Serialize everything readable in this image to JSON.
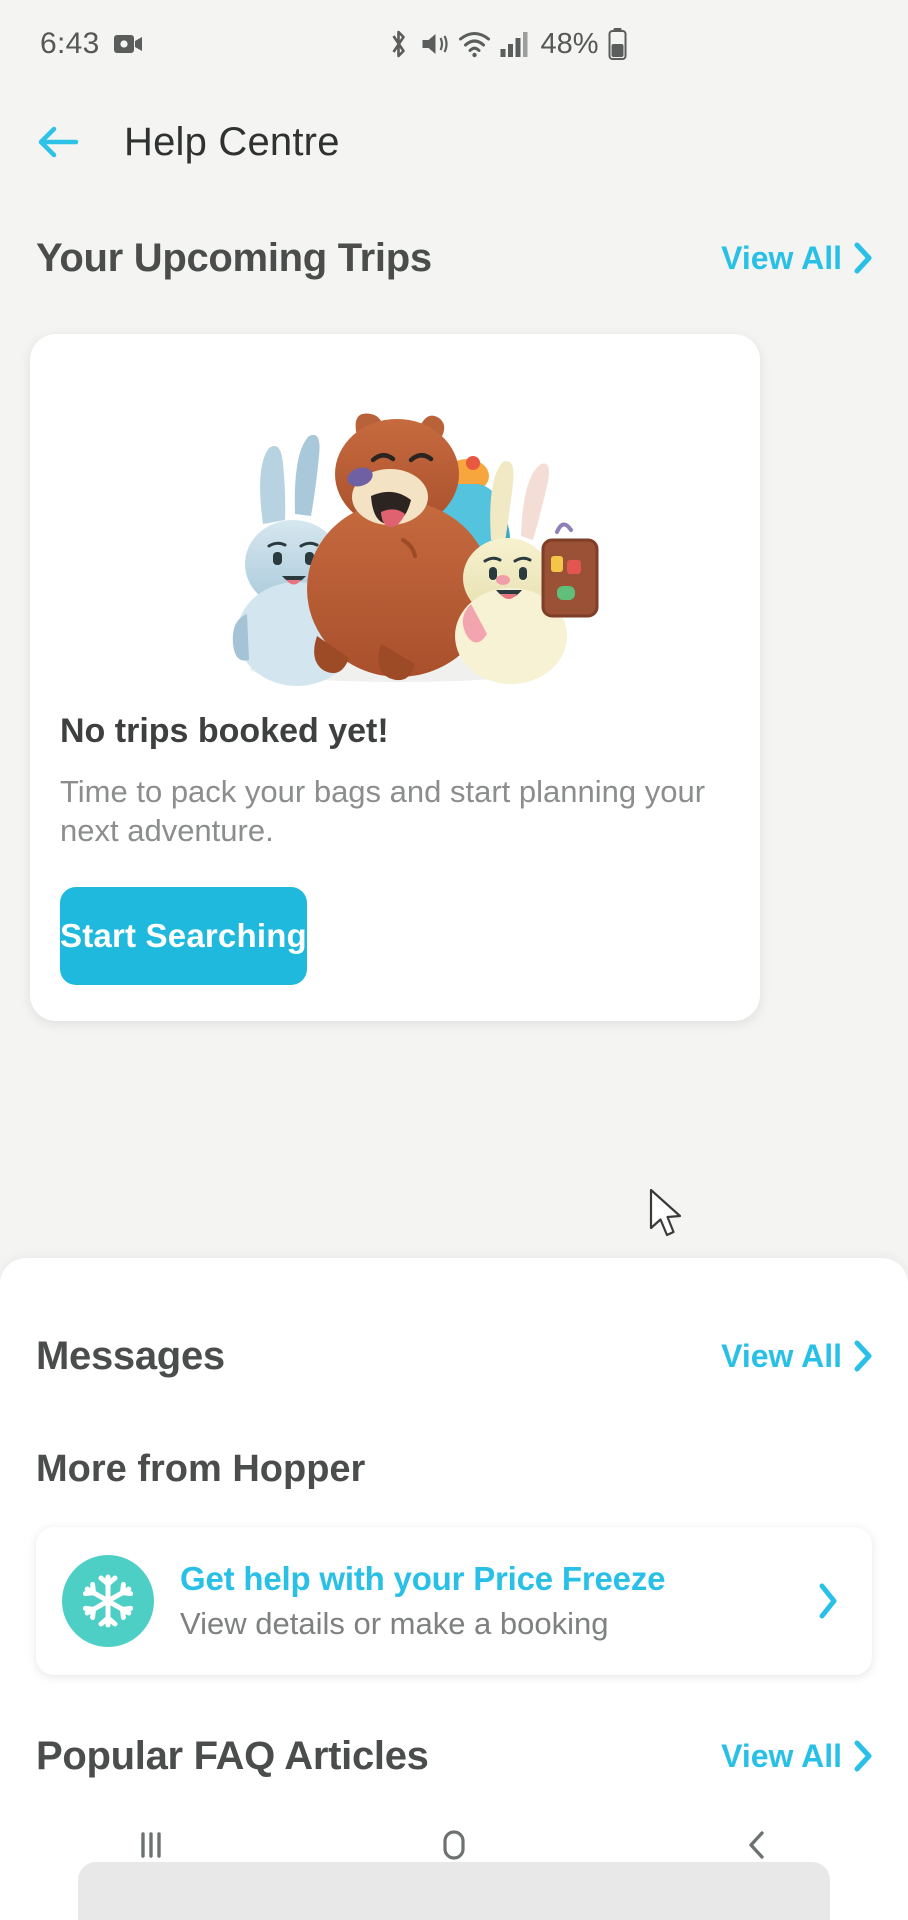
{
  "status_bar": {
    "time": "6:43",
    "battery_percent": "48%",
    "icons": [
      "video-record-icon",
      "bluetooth-icon",
      "mute-icon",
      "wifi-icon",
      "cellular-signal-icon",
      "battery-icon"
    ]
  },
  "app_bar": {
    "back_icon": "arrow-left-icon",
    "title": "Help Centre"
  },
  "trips": {
    "title": "Your Upcoming Trips",
    "view_all": "View All",
    "card": {
      "illustration": "bear-and-bunnies-illustration",
      "heading": "No trips booked yet!",
      "body": "Time to pack your bags and start planning your next adventure.",
      "cta": "Start Searching"
    }
  },
  "messages": {
    "title": "Messages",
    "view_all": "View All"
  },
  "more_from_hopper": {
    "title": "More from Hopper",
    "items": [
      {
        "icon": "snowflake-icon",
        "title": "Get help with your Price Freeze",
        "subtitle": "View details or make a booking",
        "chevron": "chevron-right-icon"
      }
    ]
  },
  "faq": {
    "title": "Popular FAQ Articles",
    "view_all": "View All"
  },
  "nav_bar": {
    "recents": "recents-icon",
    "home": "home-icon",
    "back": "back-icon"
  },
  "colors": {
    "accent_cyan": "#29c0e8",
    "button_cyan": "#1fb9dd",
    "icon_teal": "#4ecfc6",
    "page_bg": "#f4f5f3",
    "text_dark": "#3d403f",
    "text_muted": "#8b8e8d"
  }
}
